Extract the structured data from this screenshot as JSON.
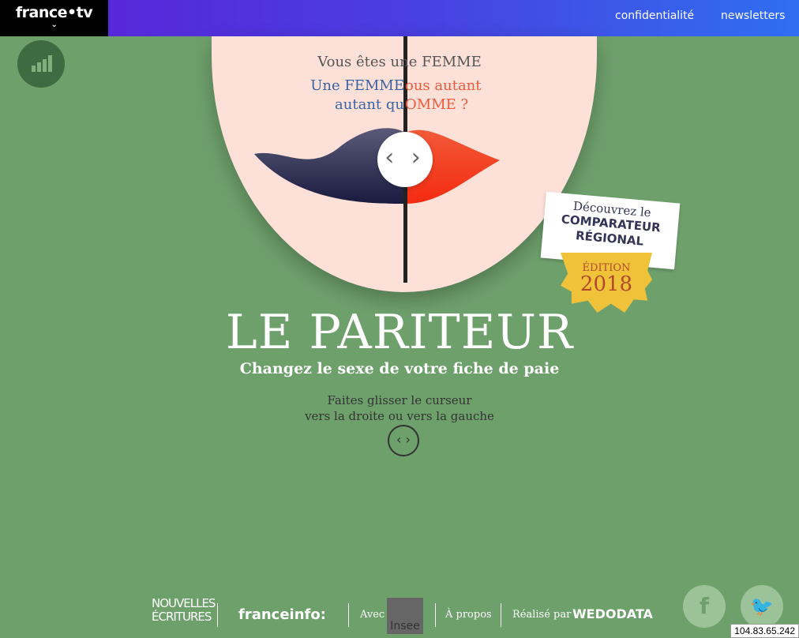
{
  "header": {
    "logo": "france•tv",
    "nav": [
      "confidentialité",
      "newsletters"
    ]
  },
  "slider": {
    "question": "Vous êtes une FEMME",
    "left_line1": "Une FEMME",
    "left_line2": "autant qu",
    "right_line1": "ous autant",
    "right_line2": "OMME ?",
    "handle": "‹ ›"
  },
  "main": {
    "title": "LE PARITEUR",
    "subtitle": "Changez le sexe de votre fiche de paie",
    "hint_line1": "Faites glisser le curseur",
    "hint_line2": "vers la droite ou vers la gauche",
    "hint_icon": "‹ ›"
  },
  "badge": {
    "line1": "Découvrez le",
    "line2": "COMPARATEUR",
    "line3": "RÉGIONAL",
    "edition": "ÉDITION",
    "year": "2018"
  },
  "footer": {
    "nouvelles": "NOUVELLES ÉCRITURES",
    "franceinfo": "franceinfo:",
    "avec": "Avec",
    "insee": "Insee",
    "apropos": "À propos",
    "realise": "Réalisé par",
    "wedodata": "WEDODATA"
  },
  "status": {
    "ip": "104.83.65.242"
  },
  "colors": {
    "background": "#6ea06c",
    "blue": "#3a63a6",
    "red": "#ee5a3a"
  }
}
